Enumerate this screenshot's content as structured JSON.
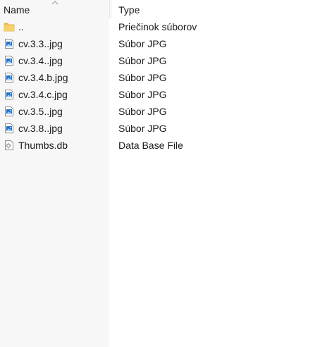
{
  "columns": {
    "name": "Name",
    "type": "Type"
  },
  "files": [
    {
      "name": "..",
      "type": "Priečinok súborov",
      "icon": "folder-icon"
    },
    {
      "name": "cv.3.3..jpg",
      "type": "Súbor JPG",
      "icon": "image-file-icon"
    },
    {
      "name": "cv.3.4..jpg",
      "type": "Súbor JPG",
      "icon": "image-file-icon"
    },
    {
      "name": "cv.3.4.b.jpg",
      "type": "Súbor JPG",
      "icon": "image-file-icon"
    },
    {
      "name": "cv.3.4.c.jpg",
      "type": "Súbor JPG",
      "icon": "image-file-icon"
    },
    {
      "name": "cv.3.5..jpg",
      "type": "Súbor JPG",
      "icon": "image-file-icon"
    },
    {
      "name": "cv.3.8..jpg",
      "type": "Súbor JPG",
      "icon": "image-file-icon"
    },
    {
      "name": "Thumbs.db",
      "type": "Data Base File",
      "icon": "database-file-icon"
    }
  ],
  "colors": {
    "folder": "#f2c14e",
    "image_accent": "#1f6fc5",
    "name_column_bg": "#f7f7f7"
  }
}
